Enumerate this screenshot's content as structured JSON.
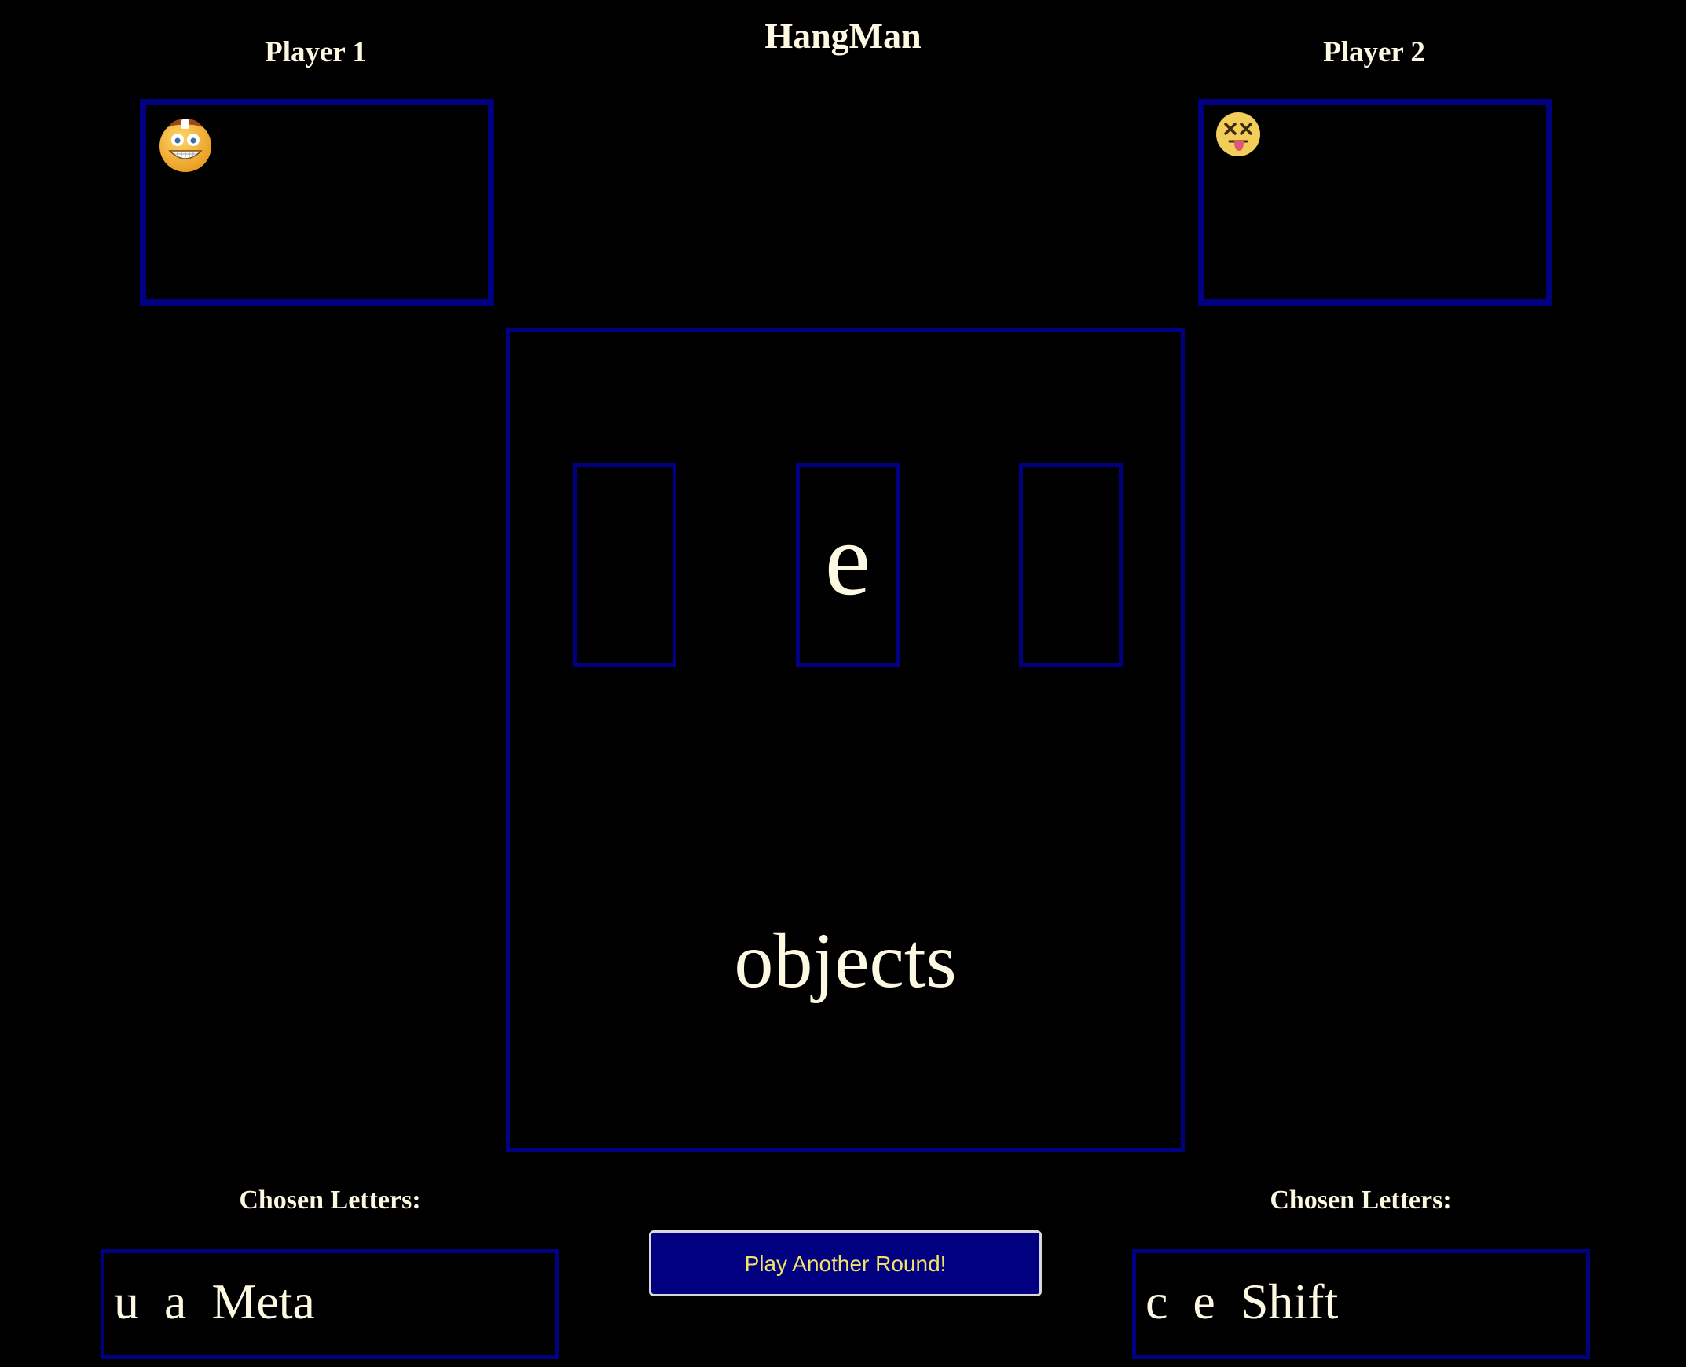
{
  "title": "HangMan",
  "player1": {
    "label": "Player 1",
    "avatar_icon": "grinning-emoji-icon",
    "chosen_label": "Chosen Letters:",
    "chosen_letters": "u  a  Meta"
  },
  "player2": {
    "label": "Player 2",
    "avatar_icon": "dizzy-face-emoji-icon",
    "chosen_label": "Chosen Letters:",
    "chosen_letters": "c  e  Shift"
  },
  "board": {
    "slots": [
      "",
      "e",
      ""
    ],
    "category": "objects"
  },
  "play_again_label": "Play Another Round!",
  "colors": {
    "background": "#000000",
    "border": "#000080",
    "text": "#fdf8e1",
    "button_text": "#f2e26a"
  }
}
